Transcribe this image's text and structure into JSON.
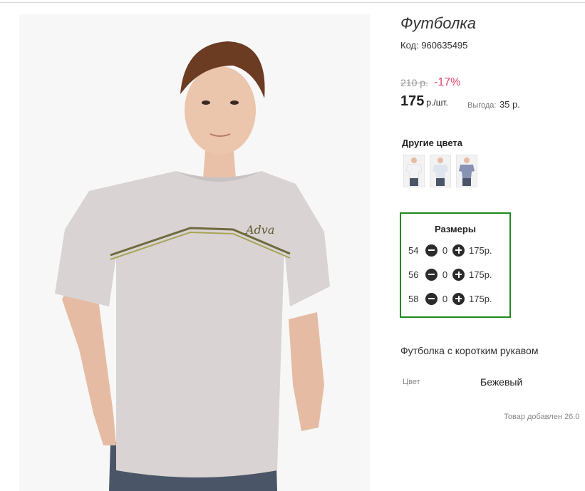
{
  "product": {
    "title": "Футболка",
    "code": "Код: 960635495",
    "old_price": "210 р.",
    "discount": "-17%",
    "price": "175",
    "price_unit": "р./шт.",
    "benefit_label": "Выгода:",
    "benefit_value": "35 р.",
    "description": "Футболка с коротким рукавом",
    "added": "Товар добавлен 26.0"
  },
  "other_colors": {
    "title": "Другие цвета",
    "swatches": [
      {
        "name": "white",
        "color": "#f3f3f5"
      },
      {
        "name": "light-grey",
        "color": "#dfe5ee"
      },
      {
        "name": "blue-grey",
        "color": "#8792b5"
      }
    ]
  },
  "sizes": {
    "title": "Размеры",
    "rows": [
      {
        "size": "54",
        "qty": "0",
        "price": "175р."
      },
      {
        "size": "56",
        "qty": "0",
        "price": "175р."
      },
      {
        "size": "58",
        "qty": "0",
        "price": "175р."
      }
    ],
    "minus_icon": "minus-circle-icon",
    "plus_icon": "plus-circle-icon"
  },
  "attributes": {
    "color_label": "Цвет",
    "color_value": "Бежевый"
  },
  "colors": {
    "discount": "#e0446b",
    "sizes_border": "#1e8a1e",
    "shirt": "#d9d3d3"
  }
}
